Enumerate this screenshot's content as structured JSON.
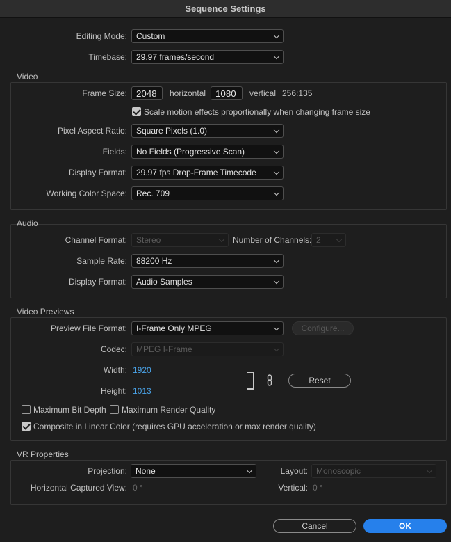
{
  "dialog": {
    "title": "Sequence Settings"
  },
  "general": {
    "editing_mode_label": "Editing Mode:",
    "editing_mode_value": "Custom",
    "timebase_label": "Timebase:",
    "timebase_value": "29.97  frames/second"
  },
  "video": {
    "group_title": "Video",
    "frame_size_label": "Frame Size:",
    "width": "2048",
    "horizontal_label": "horizontal",
    "height": "1080",
    "vertical_label": "vertical",
    "aspect": "256:135",
    "scale_checked": true,
    "scale_label": "Scale motion effects proportionally when changing frame size",
    "pixel_aspect_label": "Pixel Aspect Ratio:",
    "pixel_aspect_value": "Square Pixels (1.0)",
    "fields_label": "Fields:",
    "fields_value": "No Fields (Progressive Scan)",
    "display_format_label": "Display Format:",
    "display_format_value": "29.97 fps Drop-Frame Timecode",
    "color_space_label": "Working Color Space:",
    "color_space_value": "Rec. 709"
  },
  "audio": {
    "group_title": "Audio",
    "channel_format_label": "Channel Format:",
    "channel_format_value": "Stereo",
    "num_channels_label": "Number of Channels:",
    "num_channels_value": "2",
    "sample_rate_label": "Sample Rate:",
    "sample_rate_value": "88200 Hz",
    "display_format_label": "Display Format:",
    "display_format_value": "Audio Samples"
  },
  "previews": {
    "group_title": "Video Previews",
    "file_format_label": "Preview File Format:",
    "file_format_value": "I-Frame Only MPEG",
    "configure_label": "Configure...",
    "codec_label": "Codec:",
    "codec_value": "MPEG I-Frame",
    "width_label": "Width:",
    "width_value": "1920",
    "height_label": "Height:",
    "height_value": "1013",
    "reset_label": "Reset",
    "max_bit_depth_checked": false,
    "max_bit_depth_label": "Maximum Bit Depth",
    "max_render_quality_checked": false,
    "max_render_quality_label": "Maximum Render Quality",
    "composite_linear_checked": true,
    "composite_linear_label": "Composite in Linear Color (requires GPU acceleration or max render quality)"
  },
  "vr": {
    "group_title": "VR Properties",
    "projection_label": "Projection:",
    "projection_value": "None",
    "layout_label": "Layout:",
    "layout_value": "Monoscopic",
    "h_view_label": "Horizontal Captured View:",
    "h_view_value": "0 °",
    "vertical_label": "Vertical:",
    "vertical_value": "0 °"
  },
  "footer": {
    "cancel_label": "Cancel",
    "ok_label": "OK"
  },
  "colors": {
    "accent": "#2680eb",
    "link_value": "#4aa3e8",
    "background": "#1e1e1e"
  },
  "icons": {
    "checkbox_checked": "checkmark-icon",
    "dropdown": "chevron-down-icon",
    "constrain": "chain-link-icon"
  }
}
